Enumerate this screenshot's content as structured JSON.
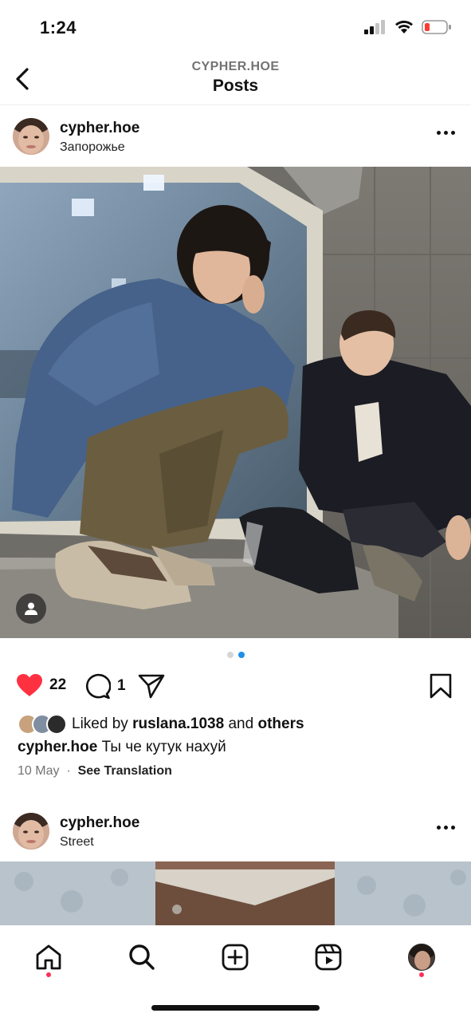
{
  "status_bar": {
    "time": "1:24"
  },
  "nav": {
    "subtitle": "CYPHER.HOE",
    "title": "Posts"
  },
  "post1": {
    "username": "cypher.hoe",
    "location": "Запорожье",
    "carousel": {
      "current": 2,
      "total": 2
    },
    "likes_count": "22",
    "comments_count": "1",
    "liked_by_prefix": "Liked by",
    "liked_by_user": "ruslana.1038",
    "liked_by_and": "and",
    "liked_by_others": "others",
    "caption_user": "cypher.hoe",
    "caption_text": "Ты че кутук нахуй",
    "date": "10 May",
    "see_translation": "See Translation",
    "liked": true
  },
  "post2": {
    "username": "cypher.hoe",
    "location": "Street"
  },
  "tabbar": {
    "items": [
      "home-icon",
      "search-icon",
      "create-icon",
      "reels-icon",
      "profile-avatar"
    ],
    "active": "home-icon"
  },
  "colors": {
    "heart": "#ff3040",
    "carousel_active": "#1e90e8",
    "notif_dot": "#ff2d55"
  }
}
